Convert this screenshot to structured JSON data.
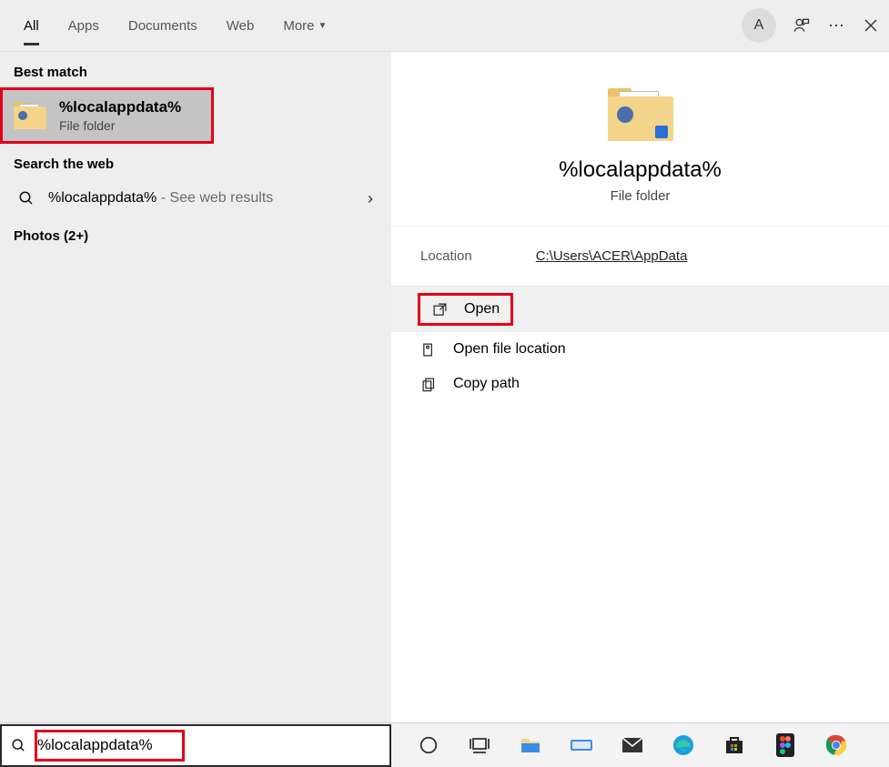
{
  "tabs": {
    "all": "All",
    "apps": "Apps",
    "documents": "Documents",
    "web": "Web",
    "more": "More"
  },
  "avatar_letter": "A",
  "sections": {
    "best_match": "Best match",
    "search_web": "Search the web",
    "photos": "Photos (2+)"
  },
  "best_match": {
    "title": "%localappdata%",
    "subtitle": "File folder"
  },
  "web_result": {
    "query": "%localappdata%",
    "suffix": " - See web results"
  },
  "preview": {
    "title": "%localappdata%",
    "subtitle": "File folder",
    "location_label": "Location",
    "location_value": "C:\\Users\\ACER\\AppData"
  },
  "actions": {
    "open": "Open",
    "open_location": "Open file location",
    "copy_path": "Copy path"
  },
  "search_value": "%localappdata%"
}
